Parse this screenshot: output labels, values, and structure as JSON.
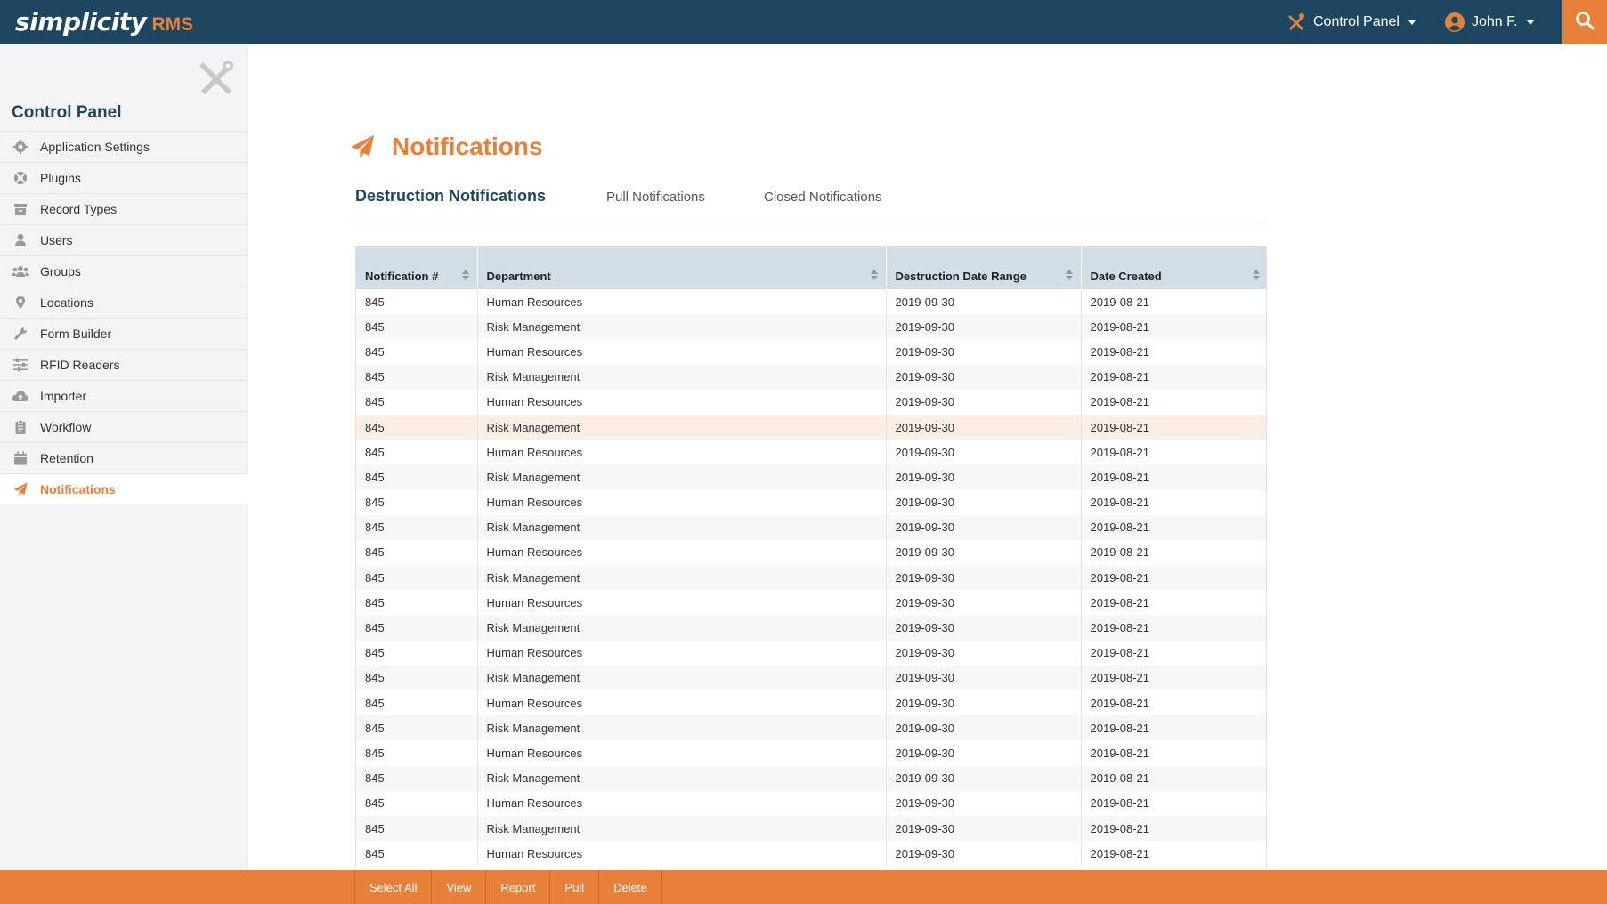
{
  "header": {
    "logo_main": "simplicity",
    "logo_sub": "RMS",
    "control_panel_label": "Control Panel",
    "user_label": "John F.",
    "icons": [
      "tools-icon",
      "user-circle-icon",
      "search-icon"
    ],
    "colors": {
      "navbar": "#1d4660",
      "accent": "#e8803a"
    }
  },
  "sidebar": {
    "title": "Control Panel",
    "items": [
      {
        "label": "Application Settings",
        "icon": "gear-icon"
      },
      {
        "label": "Plugins",
        "icon": "plugin-icon"
      },
      {
        "label": "Record Types",
        "icon": "archive-box-icon"
      },
      {
        "label": "Users",
        "icon": "user-icon"
      },
      {
        "label": "Groups",
        "icon": "users-group-icon"
      },
      {
        "label": "Locations",
        "icon": "map-pin-icon"
      },
      {
        "label": "Form Builder",
        "icon": "wrench-icon"
      },
      {
        "label": "RFID Readers",
        "icon": "sliders-icon"
      },
      {
        "label": "Importer",
        "icon": "cloud-upload-icon"
      },
      {
        "label": "Workflow",
        "icon": "clipboard-icon"
      },
      {
        "label": "Retention",
        "icon": "calendar-icon"
      },
      {
        "label": "Notifications",
        "icon": "paper-plane-icon",
        "active": true
      }
    ]
  },
  "main": {
    "title": "Notifications",
    "tabs": [
      {
        "label": "Destruction Notifications",
        "active": true
      },
      {
        "label": "Pull Notifications"
      },
      {
        "label": "Closed Notifications"
      }
    ],
    "table": {
      "columns": [
        "Notification #",
        "Department",
        "Destruction Date Range",
        "Date Created"
      ],
      "rows": [
        [
          "845",
          "Human Resources",
          "2019-09-30",
          "2019-08-21"
        ],
        [
          "845",
          "Risk Management",
          "2019-09-30",
          "2019-08-21"
        ],
        [
          "845",
          "Human Resources",
          "2019-09-30",
          "2019-08-21"
        ],
        [
          "845",
          "Risk Management",
          "2019-09-30",
          "2019-08-21"
        ],
        [
          "845",
          "Human Resources",
          "2019-09-30",
          "2019-08-21"
        ],
        [
          "845",
          "Risk Management",
          "2019-09-30",
          "2019-08-21"
        ],
        [
          "845",
          "Human Resources",
          "2019-09-30",
          "2019-08-21"
        ],
        [
          "845",
          "Risk Management",
          "2019-09-30",
          "2019-08-21"
        ],
        [
          "845",
          "Human Resources",
          "2019-09-30",
          "2019-08-21"
        ],
        [
          "845",
          "Risk Management",
          "2019-09-30",
          "2019-08-21"
        ],
        [
          "845",
          "Human Resources",
          "2019-09-30",
          "2019-08-21"
        ],
        [
          "845",
          "Risk Management",
          "2019-09-30",
          "2019-08-21"
        ],
        [
          "845",
          "Human Resources",
          "2019-09-30",
          "2019-08-21"
        ],
        [
          "845",
          "Risk Management",
          "2019-09-30",
          "2019-08-21"
        ],
        [
          "845",
          "Human Resources",
          "2019-09-30",
          "2019-08-21"
        ],
        [
          "845",
          "Risk Management",
          "2019-09-30",
          "2019-08-21"
        ],
        [
          "845",
          "Human Resources",
          "2019-09-30",
          "2019-08-21"
        ],
        [
          "845",
          "Risk Management",
          "2019-09-30",
          "2019-08-21"
        ],
        [
          "845",
          "Human Resources",
          "2019-09-30",
          "2019-08-21"
        ],
        [
          "845",
          "Risk Management",
          "2019-09-30",
          "2019-08-21"
        ],
        [
          "845",
          "Human Resources",
          "2019-09-30",
          "2019-08-21"
        ],
        [
          "845",
          "Risk Management",
          "2019-09-30",
          "2019-08-21"
        ],
        [
          "845",
          "Human Resources",
          "2019-09-30",
          "2019-08-21"
        ]
      ],
      "highlighted_row": 5
    }
  },
  "actions": [
    "Select All",
    "View",
    "Report",
    "Pull",
    "Delete"
  ]
}
